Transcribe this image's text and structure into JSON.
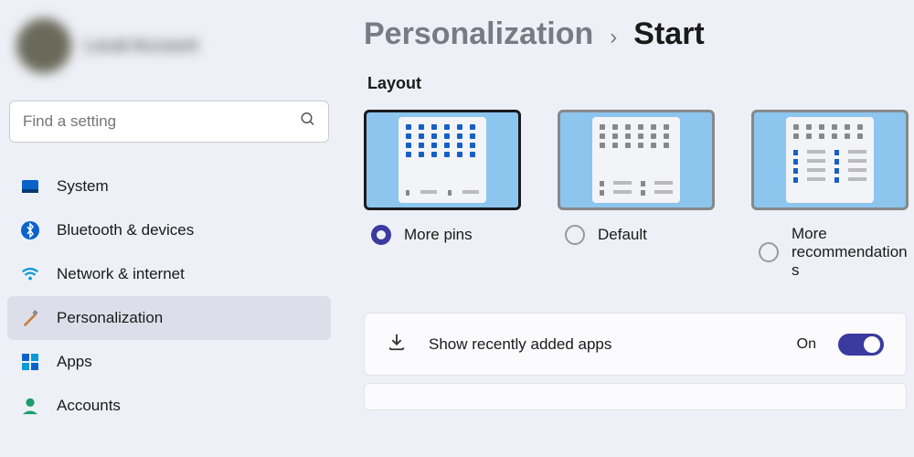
{
  "profile": {
    "name": "Local Account"
  },
  "search": {
    "placeholder": "Find a setting"
  },
  "nav": [
    {
      "label": "System",
      "icon": "system"
    },
    {
      "label": "Bluetooth & devices",
      "icon": "bluetooth"
    },
    {
      "label": "Network & internet",
      "icon": "wifi"
    },
    {
      "label": "Personalization",
      "icon": "paint"
    },
    {
      "label": "Apps",
      "icon": "apps"
    },
    {
      "label": "Accounts",
      "icon": "account"
    }
  ],
  "breadcrumb": {
    "parent": "Personalization",
    "sep": "›",
    "current": "Start"
  },
  "layout": {
    "title": "Layout",
    "options": [
      {
        "label": "More pins",
        "selected": true
      },
      {
        "label": "Default",
        "selected": false
      },
      {
        "label": "More recommendations",
        "selected": false
      }
    ]
  },
  "settings": [
    {
      "label": "Show recently added apps",
      "state": "On",
      "icon": "download"
    }
  ]
}
